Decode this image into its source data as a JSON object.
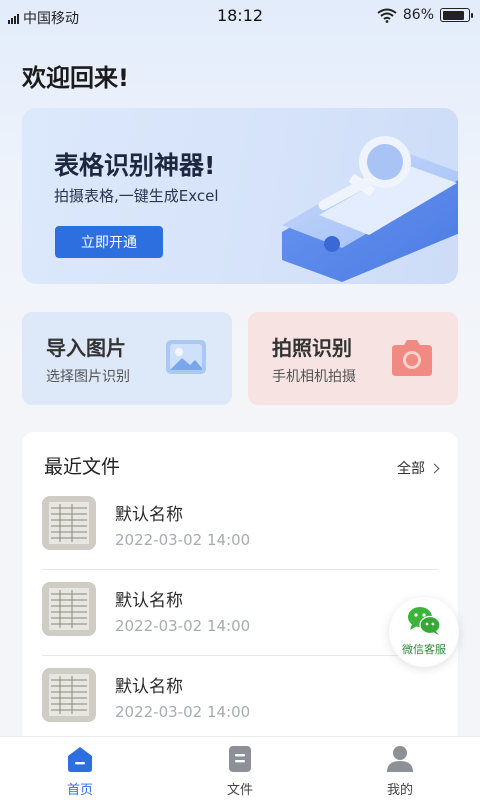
{
  "status_bar": {
    "carrier": "中国移动",
    "time": "18:12",
    "battery": "86%",
    "battery_level": 0.86
  },
  "welcome": "欢迎回来!",
  "banner": {
    "title": "表格识别神器!",
    "subtitle": "拍摄表格,一键生成Excel",
    "button": "立即开通"
  },
  "actions": [
    {
      "title": "导入图片",
      "subtitle": "选择图片识别",
      "icon": "image-icon",
      "bg": "#dde8f9"
    },
    {
      "title": "拍照识别",
      "subtitle": "手机相机拍摄",
      "icon": "camera-icon",
      "bg": "#f7e3e1"
    }
  ],
  "recent": {
    "title": "最近文件",
    "all_label": "全部",
    "files": [
      {
        "name": "默认名称",
        "date": "2022-03-02 14:00"
      },
      {
        "name": "默认名称",
        "date": "2022-03-02 14:00"
      },
      {
        "name": "默认名称",
        "date": "2022-03-02 14:00"
      }
    ]
  },
  "service": {
    "label": "微信客服",
    "icon": "wechat-icon"
  },
  "tabs": [
    {
      "label": "首页",
      "icon": "home-icon",
      "active": true
    },
    {
      "label": "文件",
      "icon": "file-icon",
      "active": false
    },
    {
      "label": "我的",
      "icon": "user-icon",
      "active": false
    }
  ],
  "colors": {
    "accent": "#2e6fe0",
    "wechat": "#3cb43c",
    "camera": "#f08a82"
  }
}
